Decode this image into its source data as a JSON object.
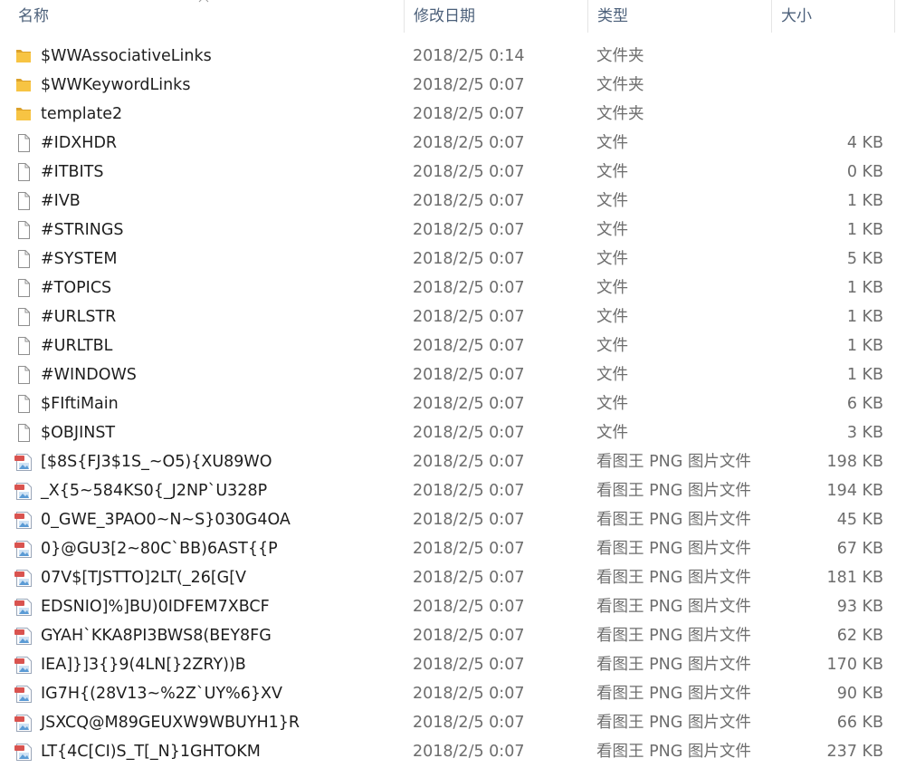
{
  "colors": {
    "folder": "#f7c443",
    "folder_dark": "#dca22b",
    "header_text": "#4c607a",
    "meta_text": "#6d6d6d"
  },
  "header": {
    "name": "名称",
    "date": "修改日期",
    "type": "类型",
    "size": "大小",
    "sort_indicator": "^"
  },
  "files": [
    {
      "name": "$WWAssociativeLinks",
      "date": "2018/2/5 0:14",
      "type": "文件夹",
      "size": "",
      "icon": "folder-icon"
    },
    {
      "name": "$WWKeywordLinks",
      "date": "2018/2/5 0:07",
      "type": "文件夹",
      "size": "",
      "icon": "folder-icon"
    },
    {
      "name": "template2",
      "date": "2018/2/5 0:07",
      "type": "文件夹",
      "size": "",
      "icon": "folder-icon"
    },
    {
      "name": "#IDXHDR",
      "date": "2018/2/5 0:07",
      "type": "文件",
      "size": "4 KB",
      "icon": "file-icon"
    },
    {
      "name": "#ITBITS",
      "date": "2018/2/5 0:07",
      "type": "文件",
      "size": "0 KB",
      "icon": "file-icon"
    },
    {
      "name": "#IVB",
      "date": "2018/2/5 0:07",
      "type": "文件",
      "size": "1 KB",
      "icon": "file-icon"
    },
    {
      "name": "#STRINGS",
      "date": "2018/2/5 0:07",
      "type": "文件",
      "size": "1 KB",
      "icon": "file-icon"
    },
    {
      "name": "#SYSTEM",
      "date": "2018/2/5 0:07",
      "type": "文件",
      "size": "5 KB",
      "icon": "file-icon"
    },
    {
      "name": "#TOPICS",
      "date": "2018/2/5 0:07",
      "type": "文件",
      "size": "1 KB",
      "icon": "file-icon"
    },
    {
      "name": "#URLSTR",
      "date": "2018/2/5 0:07",
      "type": "文件",
      "size": "1 KB",
      "icon": "file-icon"
    },
    {
      "name": "#URLTBL",
      "date": "2018/2/5 0:07",
      "type": "文件",
      "size": "1 KB",
      "icon": "file-icon"
    },
    {
      "name": "#WINDOWS",
      "date": "2018/2/5 0:07",
      "type": "文件",
      "size": "1 KB",
      "icon": "file-icon"
    },
    {
      "name": "$FIftiMain",
      "date": "2018/2/5 0:07",
      "type": "文件",
      "size": "6 KB",
      "icon": "file-icon"
    },
    {
      "name": "$OBJINST",
      "date": "2018/2/5 0:07",
      "type": "文件",
      "size": "3 KB",
      "icon": "file-icon"
    },
    {
      "name": "[$8S{FJ3$1S_~O5){XU89WO",
      "date": "2018/2/5 0:07",
      "type": "看图王 PNG 图片文件",
      "size": "198 KB",
      "icon": "png-image-icon"
    },
    {
      "name": "_X{5~584KS0{_J2NP`U328P",
      "date": "2018/2/5 0:07",
      "type": "看图王 PNG 图片文件",
      "size": "194 KB",
      "icon": "png-image-icon"
    },
    {
      "name": "0_GWE_3PAO0~N~S}030G4OA",
      "date": "2018/2/5 0:07",
      "type": "看图王 PNG 图片文件",
      "size": "45 KB",
      "icon": "png-image-icon"
    },
    {
      "name": "0}@GU3[2~80C`BB)6AST{{P",
      "date": "2018/2/5 0:07",
      "type": "看图王 PNG 图片文件",
      "size": "67 KB",
      "icon": "png-image-icon"
    },
    {
      "name": "07V$[TJSTTO]2LT(_26[G[V",
      "date": "2018/2/5 0:07",
      "type": "看图王 PNG 图片文件",
      "size": "181 KB",
      "icon": "png-image-icon"
    },
    {
      "name": "EDSNIO]%]BU)0IDFEM7XBCF",
      "date": "2018/2/5 0:07",
      "type": "看图王 PNG 图片文件",
      "size": "93 KB",
      "icon": "png-image-icon"
    },
    {
      "name": "GYAH`KKA8PI3BWS8(BEY8FG",
      "date": "2018/2/5 0:07",
      "type": "看图王 PNG 图片文件",
      "size": "62 KB",
      "icon": "png-image-icon"
    },
    {
      "name": "IEA]}]3{}9(4LN[}2ZRY))B",
      "date": "2018/2/5 0:07",
      "type": "看图王 PNG 图片文件",
      "size": "170 KB",
      "icon": "png-image-icon"
    },
    {
      "name": "IG7H{(28V13~%2Z`UY%6}XV",
      "date": "2018/2/5 0:07",
      "type": "看图王 PNG 图片文件",
      "size": "90 KB",
      "icon": "png-image-icon"
    },
    {
      "name": "JSXCQ@M89GEUXW9WBUYH1}R",
      "date": "2018/2/5 0:07",
      "type": "看图王 PNG 图片文件",
      "size": "66 KB",
      "icon": "png-image-icon"
    },
    {
      "name": "LT{4C[CI)S_T[_N}1GHTOKM",
      "date": "2018/2/5 0:07",
      "type": "看图王 PNG 图片文件",
      "size": "237 KB",
      "icon": "png-image-icon"
    }
  ]
}
